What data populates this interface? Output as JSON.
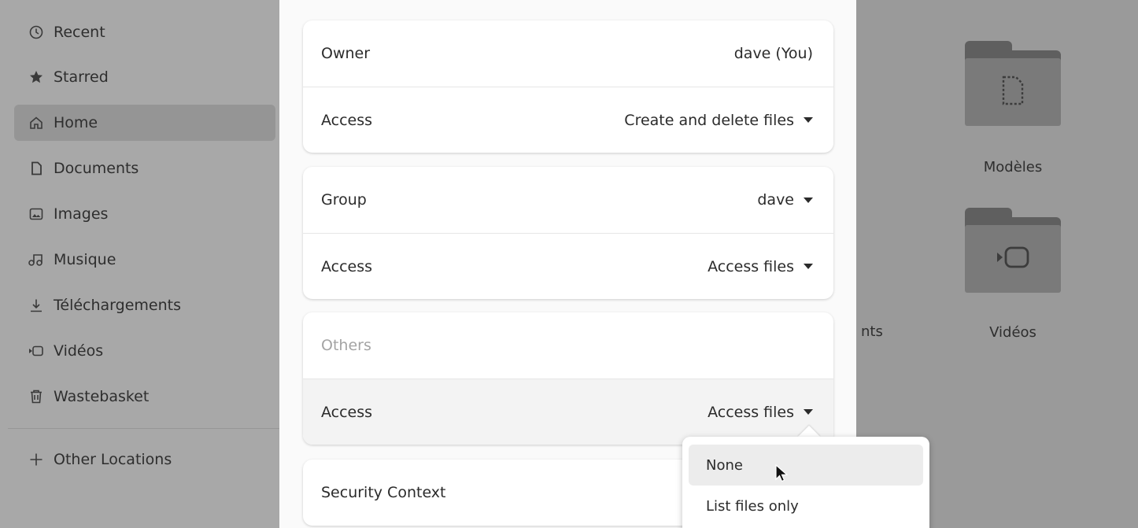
{
  "sidebar": {
    "items": [
      {
        "label": "Recent",
        "icon": "clock-icon"
      },
      {
        "label": "Starred",
        "icon": "star-icon"
      },
      {
        "label": "Home",
        "icon": "home-icon",
        "active": true
      },
      {
        "label": "Documents",
        "icon": "document-icon"
      },
      {
        "label": "Images",
        "icon": "image-icon"
      },
      {
        "label": "Musique",
        "icon": "music-icon"
      },
      {
        "label": "Téléchargements",
        "icon": "download-icon"
      },
      {
        "label": "Vidéos",
        "icon": "video-icon"
      },
      {
        "label": "Wastebasket",
        "icon": "trash-icon"
      }
    ],
    "other_locations": "Other Locations"
  },
  "files": {
    "folders": [
      {
        "label": "Modèles",
        "icon": "template-icon"
      },
      {
        "label": "Vidéos",
        "icon": "video-icon"
      }
    ],
    "partial_label": "nts"
  },
  "permissions": {
    "owner": {
      "label": "Owner",
      "value": "dave (You)"
    },
    "owner_access": {
      "label": "Access",
      "value": "Create and delete files"
    },
    "group": {
      "label": "Group",
      "value": "dave"
    },
    "group_access": {
      "label": "Access",
      "value": "Access files"
    },
    "others": {
      "label": "Others"
    },
    "others_access": {
      "label": "Access",
      "value": "Access files"
    },
    "security_context": {
      "label": "Security Context"
    }
  },
  "popover": {
    "options": [
      "None",
      "List files only"
    ],
    "hovered": "None"
  }
}
